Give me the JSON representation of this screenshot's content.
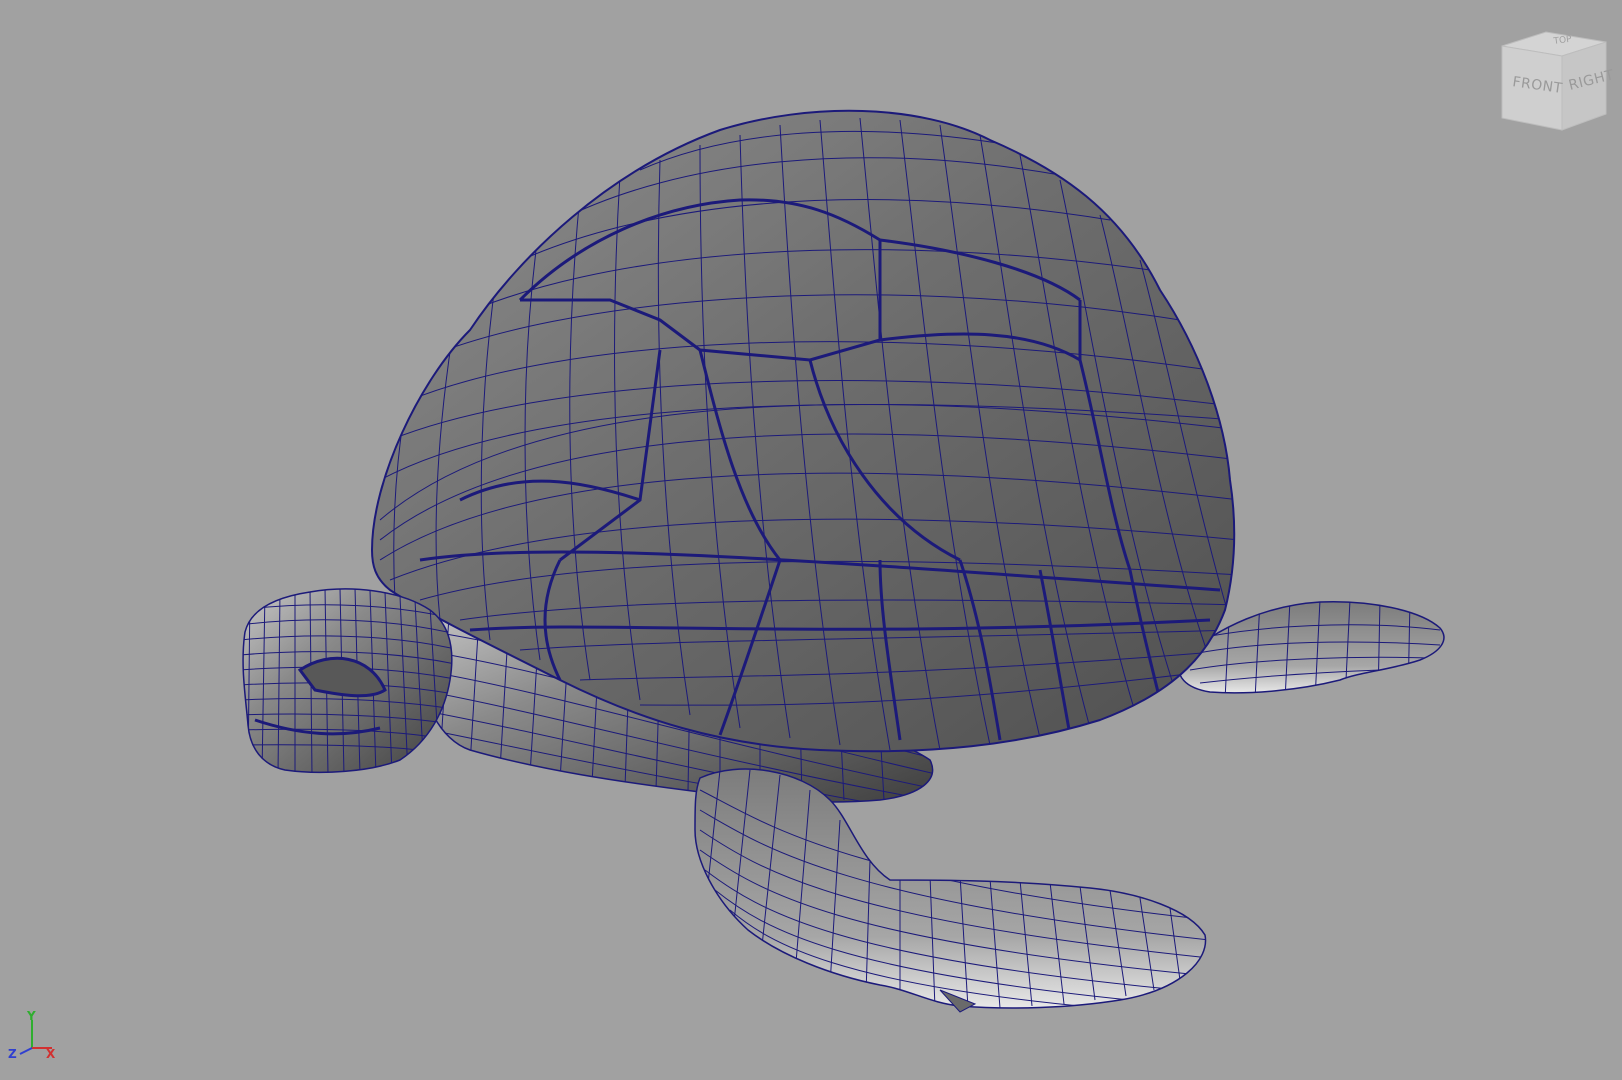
{
  "viewport": {
    "background_color": "#a1a1a1",
    "wire_color": "#1c1a7a",
    "model": "turtle-mesh"
  },
  "viewcube": {
    "front_label": "FRONT",
    "right_label": "RIGHT",
    "top_label": "TOP"
  },
  "axis": {
    "x_label": "X",
    "y_label": "Y",
    "z_label": "Z",
    "x_color": "#d23030",
    "y_color": "#2fae2f",
    "z_color": "#2f3fcf"
  }
}
